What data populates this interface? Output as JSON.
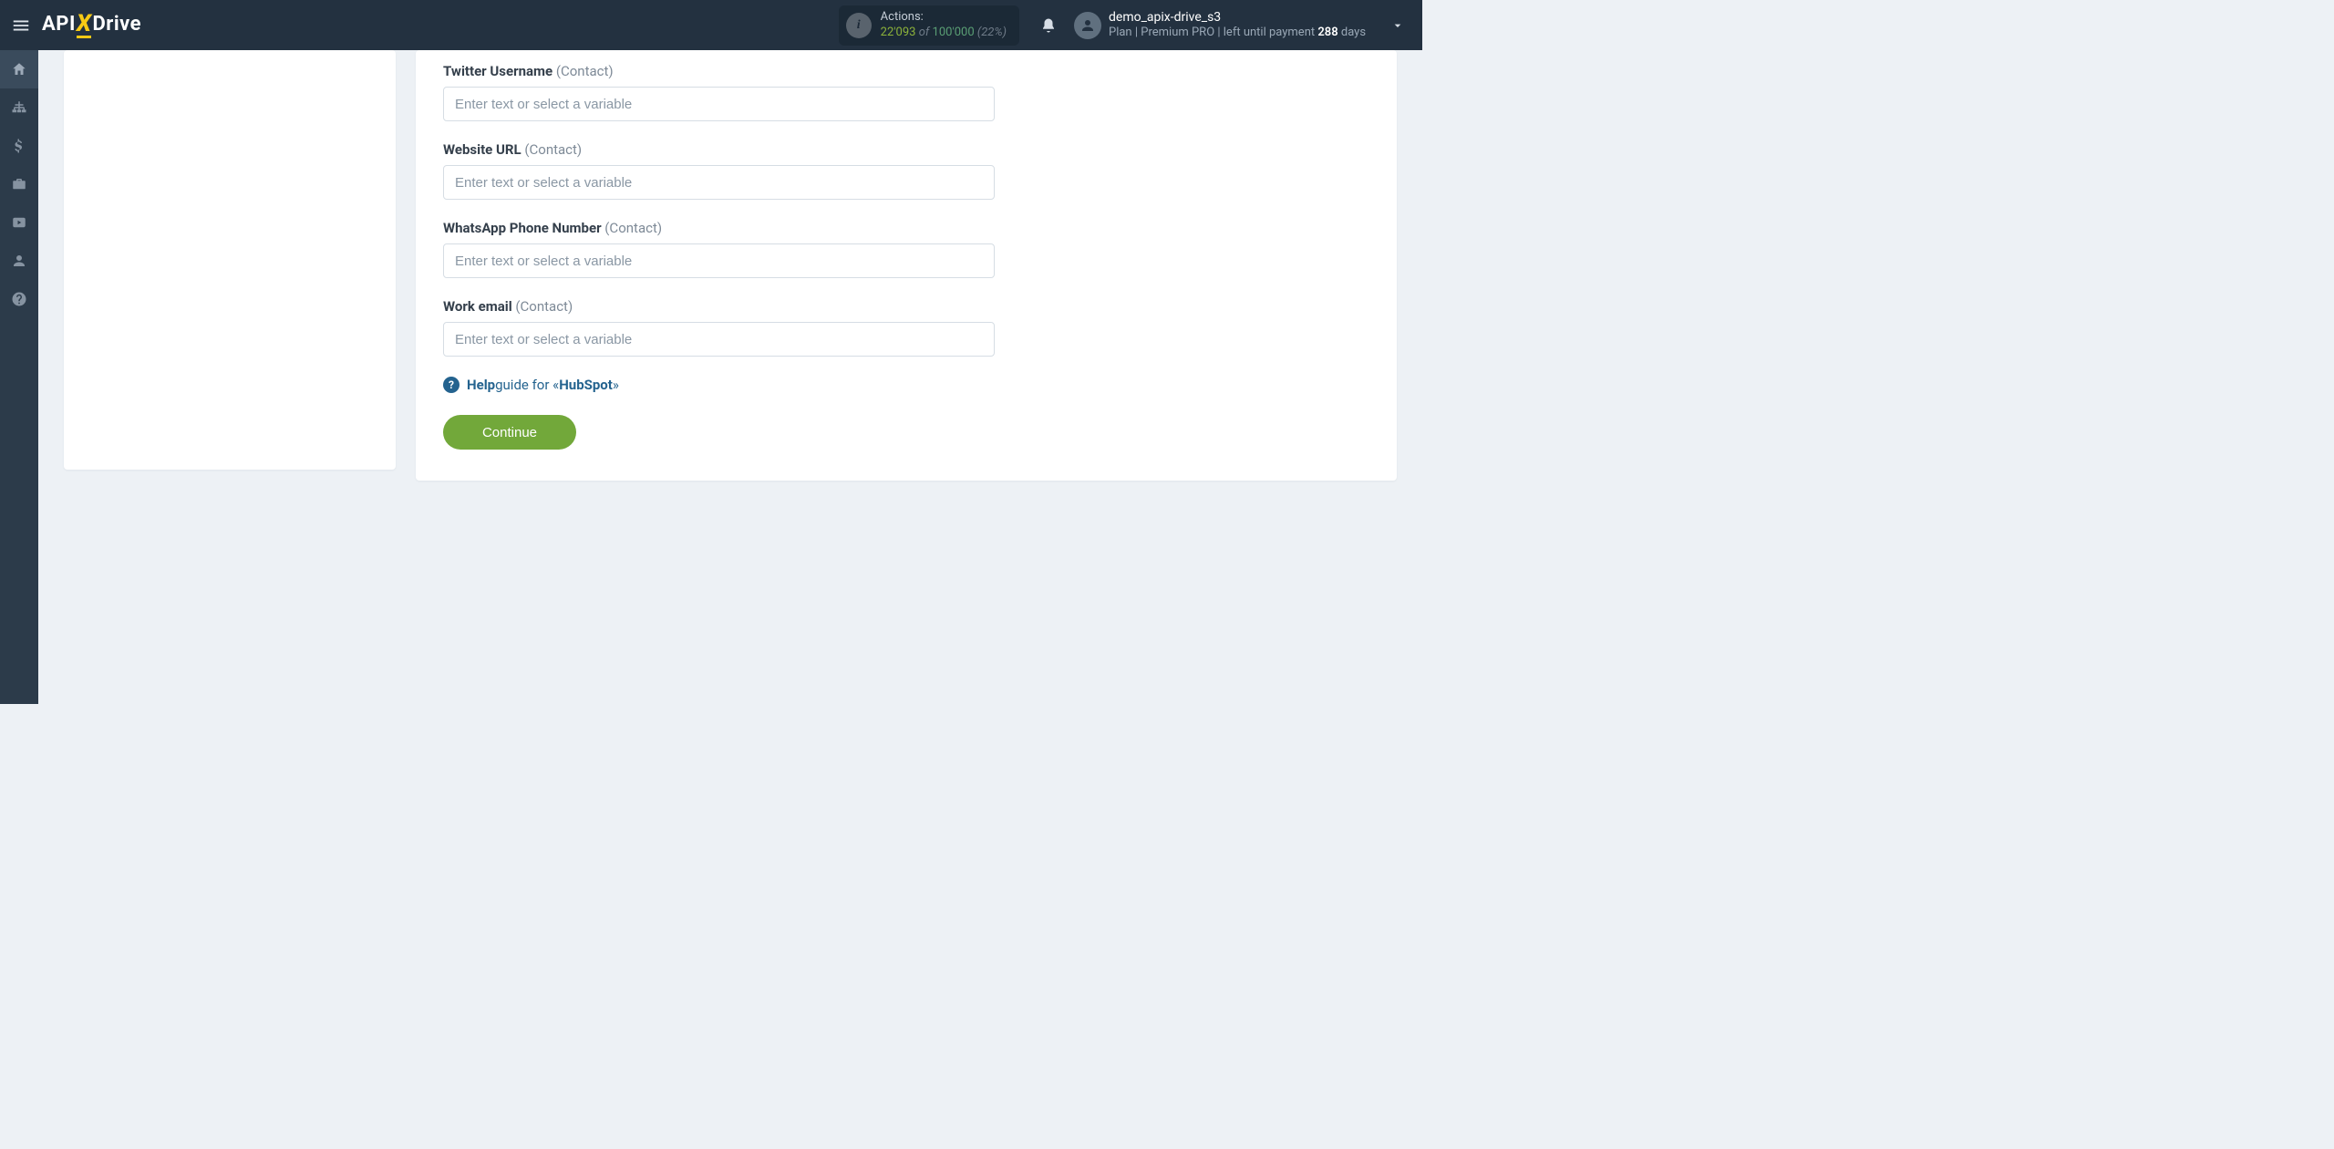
{
  "topbar": {
    "actions_label": "Actions:",
    "actions_used": "22'093",
    "actions_of": "of",
    "actions_total": "100'000",
    "actions_pct": "(22%)",
    "bell_icon": "bell",
    "user_name": "demo_apix-drive_s3",
    "plan_prefix": "Plan |",
    "plan_name": "Premium PRO",
    "plan_mid": "| left until payment",
    "plan_days_num": "288",
    "plan_days_word": "days"
  },
  "logo": {
    "api": "API",
    "x": "X",
    "drive": "Drive"
  },
  "sidebar": {
    "items": [
      {
        "name": "home"
      },
      {
        "name": "sitemap"
      },
      {
        "name": "dollar"
      },
      {
        "name": "briefcase"
      },
      {
        "name": "youtube"
      },
      {
        "name": "user"
      },
      {
        "name": "help"
      }
    ]
  },
  "form": {
    "fields": [
      {
        "label": "Twitter Username",
        "hint": "(Contact)",
        "placeholder": "Enter text or select a variable"
      },
      {
        "label": "Website URL",
        "hint": "(Contact)",
        "placeholder": "Enter text or select a variable"
      },
      {
        "label": "WhatsApp Phone Number",
        "hint": "(Contact)",
        "placeholder": "Enter text or select a variable"
      },
      {
        "label": "Work email",
        "hint": "(Contact)",
        "placeholder": "Enter text or select a variable"
      }
    ],
    "help_bold": "Help",
    "help_text": " guide for «",
    "help_service": "HubSpot",
    "help_close": "»",
    "continue": "Continue"
  }
}
